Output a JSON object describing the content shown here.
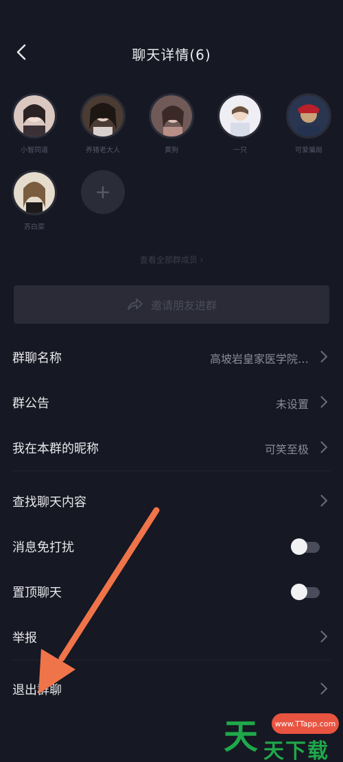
{
  "header": {
    "title": "聊天详情(6)"
  },
  "members": [
    {
      "name": "小智同道"
    },
    {
      "name": "养猪老大人"
    },
    {
      "name": "黄狗"
    },
    {
      "name": "一只"
    },
    {
      "name": "可爱骗局"
    },
    {
      "name": "苏白菜"
    }
  ],
  "add_member": {
    "symbol": "+"
  },
  "see_all": "查看全部群成员 ›",
  "share": {
    "label": "邀请朋友进群"
  },
  "settings": [
    {
      "label": "群聊名称",
      "value": "高坡岩皇家医学院…"
    },
    {
      "label": "群公告",
      "value": "未设置"
    },
    {
      "label": "我在本群的昵称",
      "value": "可笑至极"
    },
    {
      "label": "查找聊天内容",
      "value": ""
    },
    {
      "label": "消息免打扰",
      "toggle": false
    },
    {
      "label": "置顶聊天",
      "toggle": false
    },
    {
      "label": "举报",
      "value": ""
    },
    {
      "label": "退出群聊",
      "value": ""
    }
  ],
  "watermark": {
    "url": "www.TTapp.com",
    "big": "天",
    "small": "天下载"
  },
  "colors": {
    "background": "#161823",
    "arrow": "#f0744a",
    "watermark_green": "#1fa84a",
    "watermark_red": "#e95441"
  }
}
